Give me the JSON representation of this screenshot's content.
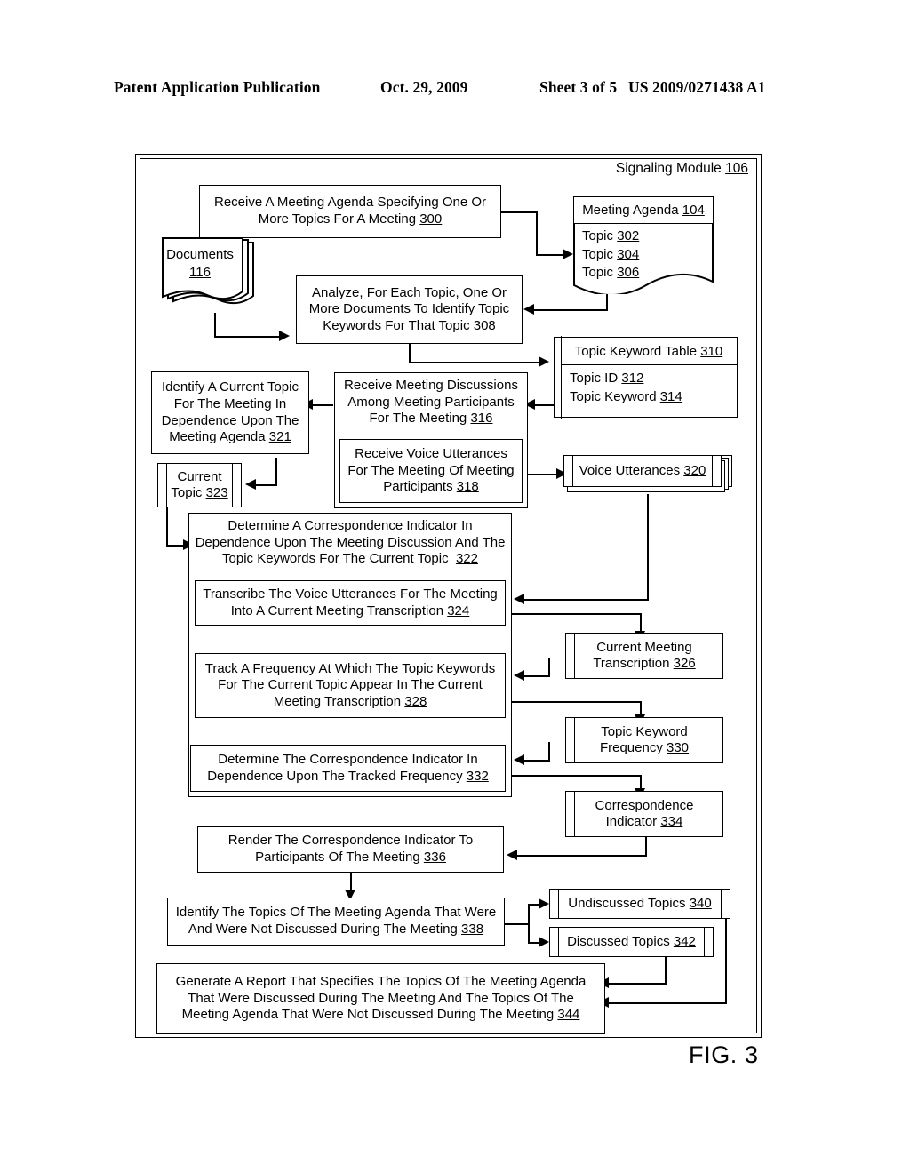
{
  "header": {
    "publication": "Patent Application Publication",
    "date": "Oct. 29, 2009",
    "sheet": "Sheet 3 of 5",
    "number": "US 2009/0271438 A1"
  },
  "figure_label": "FIG. 3",
  "diagram": {
    "container_title": "Signaling Module",
    "container_ref": "106",
    "steps": [
      {
        "id": "300",
        "text": "Receive A Meeting Agenda Specifying One Or More Topics For A Meeting",
        "ref": "300"
      },
      {
        "id": "308",
        "text": "Analyze, For Each Topic, One Or More Documents To Identify Topic Keywords For That Topic",
        "ref": "308"
      },
      {
        "id": "321",
        "text": "Identify A Current Topic For The Meeting In Dependence Upon The Meeting Agenda",
        "ref": "321"
      },
      {
        "id": "316",
        "text": "Receive Meeting Discussions Among Meeting Participants For The Meeting",
        "ref": "316"
      },
      {
        "id": "318",
        "text": "Receive Voice Utterances For The Meeting Of Meeting Participants",
        "ref": "318"
      },
      {
        "id": "322",
        "text": "Determine A Correspondence Indicator In Dependence Upon The Meeting Discussion And The Topic Keywords For The Current Topic",
        "ref": "322"
      },
      {
        "id": "324",
        "text": "Transcribe The Voice Utterances For The Meeting Into A Current Meeting Transcription",
        "ref": "324"
      },
      {
        "id": "328",
        "text": "Track A Frequency At Which The Topic Keywords For The Current Topic Appear In The Current Meeting Transcription",
        "ref": "328"
      },
      {
        "id": "332",
        "text": "Determine The Correspondence Indicator In Dependence Upon The Tracked Frequency",
        "ref": "332"
      },
      {
        "id": "336",
        "text": "Render The Correspondence Indicator To Participants Of The Meeting",
        "ref": "336"
      },
      {
        "id": "338",
        "text": "Identify The Topics Of The Meeting Agenda That Were And Were Not Discussed During The Meeting",
        "ref": "338"
      },
      {
        "id": "344",
        "text": "Generate A Report That Specifies The Topics Of The Meeting Agenda That Were Discussed During The Meeting And The Topics Of The Meeting Agenda That Were Not Discussed During The Meeting",
        "ref": "344"
      }
    ],
    "data_objects": [
      {
        "id": "116",
        "label": "Documents",
        "ref": "116"
      },
      {
        "id": "104",
        "label": "Meeting Agenda",
        "ref": "104"
      },
      {
        "id": "302",
        "label": "Topic",
        "ref": "302"
      },
      {
        "id": "304",
        "label": "Topic",
        "ref": "304"
      },
      {
        "id": "306",
        "label": "Topic",
        "ref": "306"
      },
      {
        "id": "310",
        "label": "Topic Keyword Table",
        "ref": "310"
      },
      {
        "id": "312",
        "label": "Topic ID",
        "ref": "312"
      },
      {
        "id": "314",
        "label": "Topic Keyword",
        "ref": "314"
      },
      {
        "id": "320",
        "label": "Voice Utterances",
        "ref": "320"
      },
      {
        "id": "323",
        "label": "Current Topic",
        "ref": "323"
      },
      {
        "id": "326",
        "label": "Current Meeting Transcription",
        "ref": "326"
      },
      {
        "id": "330",
        "label": "Topic Keyword Frequency",
        "ref": "330"
      },
      {
        "id": "334",
        "label": "Correspondence Indicator",
        "ref": "334"
      },
      {
        "id": "340",
        "label": "Undiscussed Topics",
        "ref": "340"
      },
      {
        "id": "342",
        "label": "Discussed Topics",
        "ref": "342"
      }
    ]
  }
}
